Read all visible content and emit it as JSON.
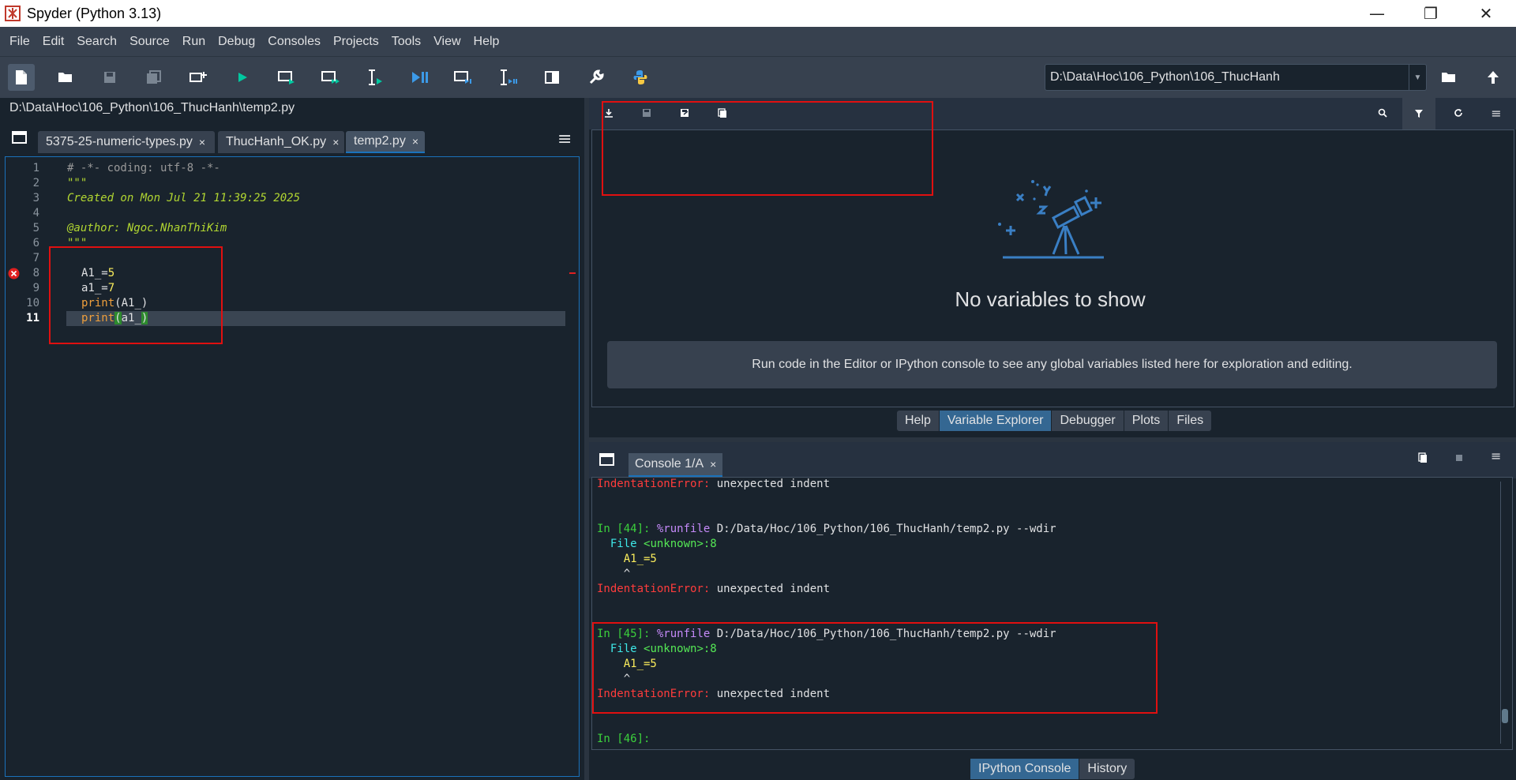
{
  "window": {
    "title": "Spyder (Python 3.13)",
    "minimize": "—",
    "maximize": "❐",
    "close": "✕"
  },
  "menu": [
    "File",
    "Edit",
    "Search",
    "Source",
    "Run",
    "Debug",
    "Consoles",
    "Projects",
    "Tools",
    "View",
    "Help"
  ],
  "toolbar": {
    "icons": [
      "new-file-icon",
      "open-file-icon",
      "save-icon",
      "save-all-icon",
      "new-cell-icon",
      "run-icon",
      "run-cell-icon",
      "run-cell-advance-icon",
      "run-selection-icon",
      "debug-icon",
      "debug-cell-icon",
      "debug-selection-icon",
      "maximize-pane-icon",
      "preferences-wrench-icon",
      "python-path-icon"
    ],
    "working_dir": "D:\\Data\\Hoc\\106_Python\\106_ThucHanh"
  },
  "editor": {
    "path": "D:\\Data\\Hoc\\106_Python\\106_ThucHanh\\temp2.py",
    "tabs": [
      {
        "label": "5375-25-numeric-types.py",
        "close": "×"
      },
      {
        "label": "ThucHanh_OK.py",
        "close": "×"
      },
      {
        "label": "temp2.py",
        "close": "×"
      }
    ],
    "active_tab": "temp2.py",
    "line_numbers": [
      "1",
      "2",
      "3",
      "4",
      "5",
      "6",
      "7",
      "8",
      "9",
      "10",
      "11"
    ],
    "current_line": 11,
    "error_line": 8,
    "lines": {
      "l1": "# -*- coding: utf-8 -*-",
      "l2": "\"\"\"",
      "l3": "Created on Mon Jul 21 11:39:25 2025",
      "l5": "@author: Ngoc.NhanThiKim",
      "l6": "\"\"\"",
      "l8a": "A1_",
      "l8b": "=",
      "l8c": "5",
      "l9a": "a1_",
      "l9b": "=",
      "l9c": "7",
      "l10a": "print",
      "l10b": "(A1_)",
      "l11a": "print",
      "l11b": "(",
      "l11c": "a1_",
      "l11d": ")"
    }
  },
  "variable_explorer": {
    "empty_title": "No variables to show",
    "empty_message": "Run code in the Editor or IPython console to see any global variables listed here for exploration and editing.",
    "toolbar_icons": [
      "import-data-icon",
      "save-data-icon",
      "save-as-icon",
      "copy-icon",
      "search-icon",
      "filter-icon",
      "refresh-icon",
      "options-menu-icon"
    ]
  },
  "top_tabs": [
    {
      "label": "Help",
      "selected": false
    },
    {
      "label": "Variable Explorer",
      "selected": true
    },
    {
      "label": "Debugger",
      "selected": false
    },
    {
      "label": "Plots",
      "selected": false
    },
    {
      "label": "Files",
      "selected": false
    }
  ],
  "console": {
    "tab_label": "Console 1/A",
    "tab_close": "×",
    "lines": {
      "err1_name": "IndentationError:",
      "err1_msg": " unexpected indent",
      "in44_prompt": "In [44]:",
      "cmd_magic": " %runfile",
      "cmd_path": " D:/Data/Hoc/106_Python/106_ThucHanh/temp2.py --wdir",
      "file_loc_a": "  File ",
      "file_loc_b": "<unknown>:8",
      "src_line": "    A1_=5",
      "caret": "    ^",
      "err_name": "IndentationError:",
      "err_msg": " unexpected indent",
      "in45_prompt": "In [45]:",
      "in46_prompt": "In [46]:"
    }
  },
  "bottom_tabs": [
    {
      "label": "IPython Console",
      "selected": true
    },
    {
      "label": "History",
      "selected": false
    }
  ],
  "colors": {
    "background": "#19232d",
    "panel": "#37414f",
    "accent": "#1a72bb",
    "highlight_box": "#e01010"
  }
}
